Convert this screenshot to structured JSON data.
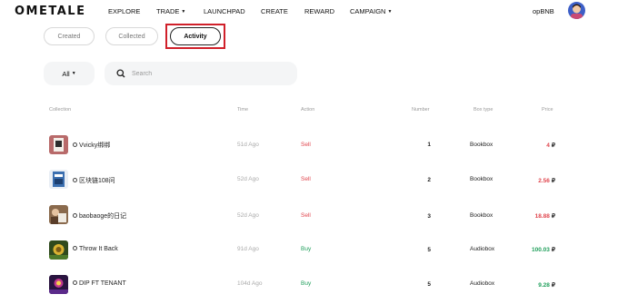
{
  "nav": {
    "logo": "OMETALE",
    "items": [
      "EXPLORE",
      "TRADE",
      "LAUNCHPAD",
      "CREATE",
      "REWARD",
      "CAMPAIGN"
    ],
    "network": "opBNB"
  },
  "tabs": [
    "Created",
    "Collected",
    "Activity"
  ],
  "active_tab": "Activity",
  "filter": {
    "value": "All"
  },
  "search": {
    "placeholder": "Search"
  },
  "table": {
    "headers": [
      "Collection",
      "Time",
      "Action",
      "Number",
      "Box type",
      "Price"
    ],
    "currency_symbol": "₽",
    "rows": [
      {
        "collection": "Vvicky绑绑",
        "time": "51d Ago",
        "action": "Sell",
        "number": "1",
        "box_type": "Bookbox",
        "price": "4"
      },
      {
        "collection": "区块链108问",
        "time": "52d Ago",
        "action": "Sell",
        "number": "2",
        "box_type": "Bookbox",
        "price": "2.56"
      },
      {
        "collection": "baobaoge的日记",
        "time": "52d Ago",
        "action": "Sell",
        "number": "3",
        "box_type": "Bookbox",
        "price": "18.88"
      },
      {
        "collection": "Throw It Back",
        "time": "91d Ago",
        "action": "Buy",
        "number": "5",
        "box_type": "Audiobox",
        "price": "100.03"
      },
      {
        "collection": "DIP FT TENANT",
        "time": "104d Ago",
        "action": "Buy",
        "number": "5",
        "box_type": "Audiobox",
        "price": "9.28"
      }
    ]
  },
  "colors": {
    "sell": "#e0454d",
    "buy": "#1e9e5a",
    "highlight": "#d0202a"
  }
}
